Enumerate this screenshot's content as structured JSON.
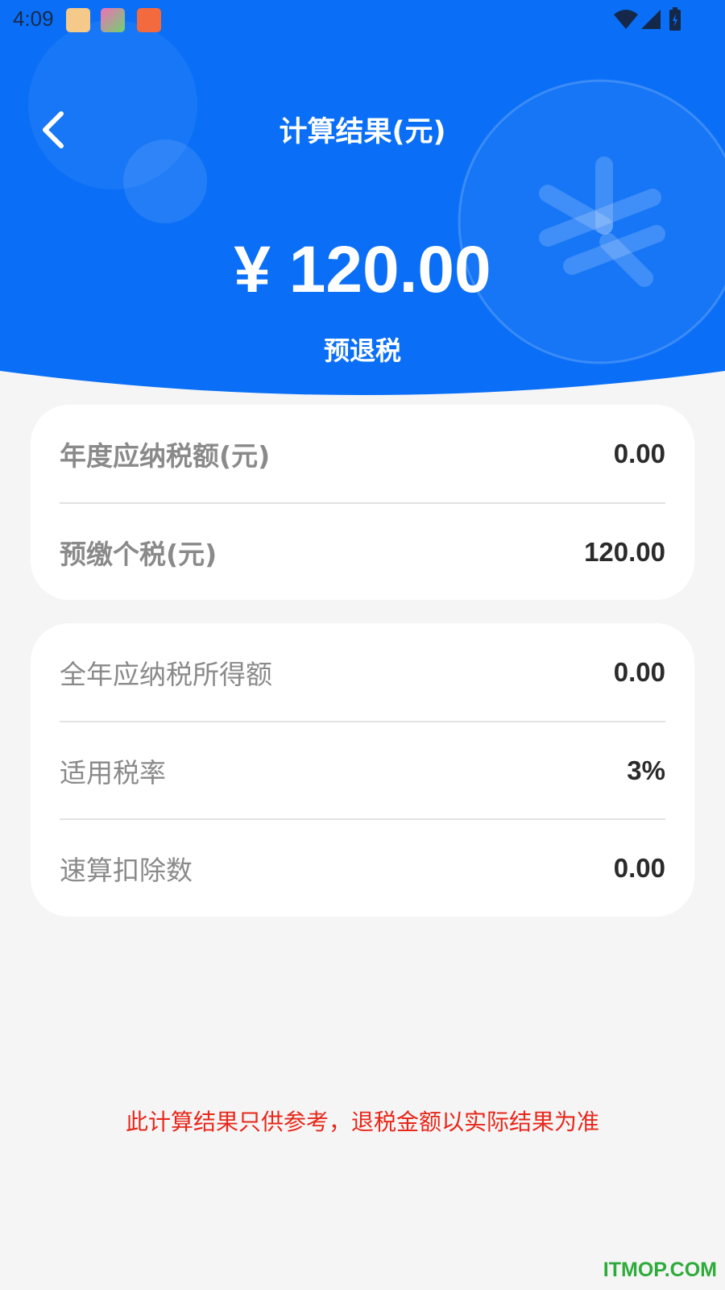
{
  "status_bar": {
    "time": "4:09"
  },
  "header": {
    "title": "计算结果(元)",
    "amount": "¥ 120.00",
    "amount_label": "预退税",
    "background_color": "#0a6ff6"
  },
  "summary_card": {
    "rows": [
      {
        "label": "年度应纳税额(元)",
        "value": "0.00"
      },
      {
        "label": "预缴个税(元)",
        "value": "120.00"
      }
    ]
  },
  "detail_card": {
    "rows": [
      {
        "label": "全年应纳税所得额",
        "value": "0.00"
      },
      {
        "label": "适用税率",
        "value": "3%"
      },
      {
        "label": "速算扣除数",
        "value": "0.00"
      }
    ]
  },
  "disclaimer": "此计算结果只供参考，退税金额以实际结果为准",
  "watermark": "ITMOP.COM",
  "icons": [
    "back-arrow-icon",
    "wifi-icon",
    "signal-icon",
    "battery-icon",
    "yuan-coin-icon"
  ]
}
